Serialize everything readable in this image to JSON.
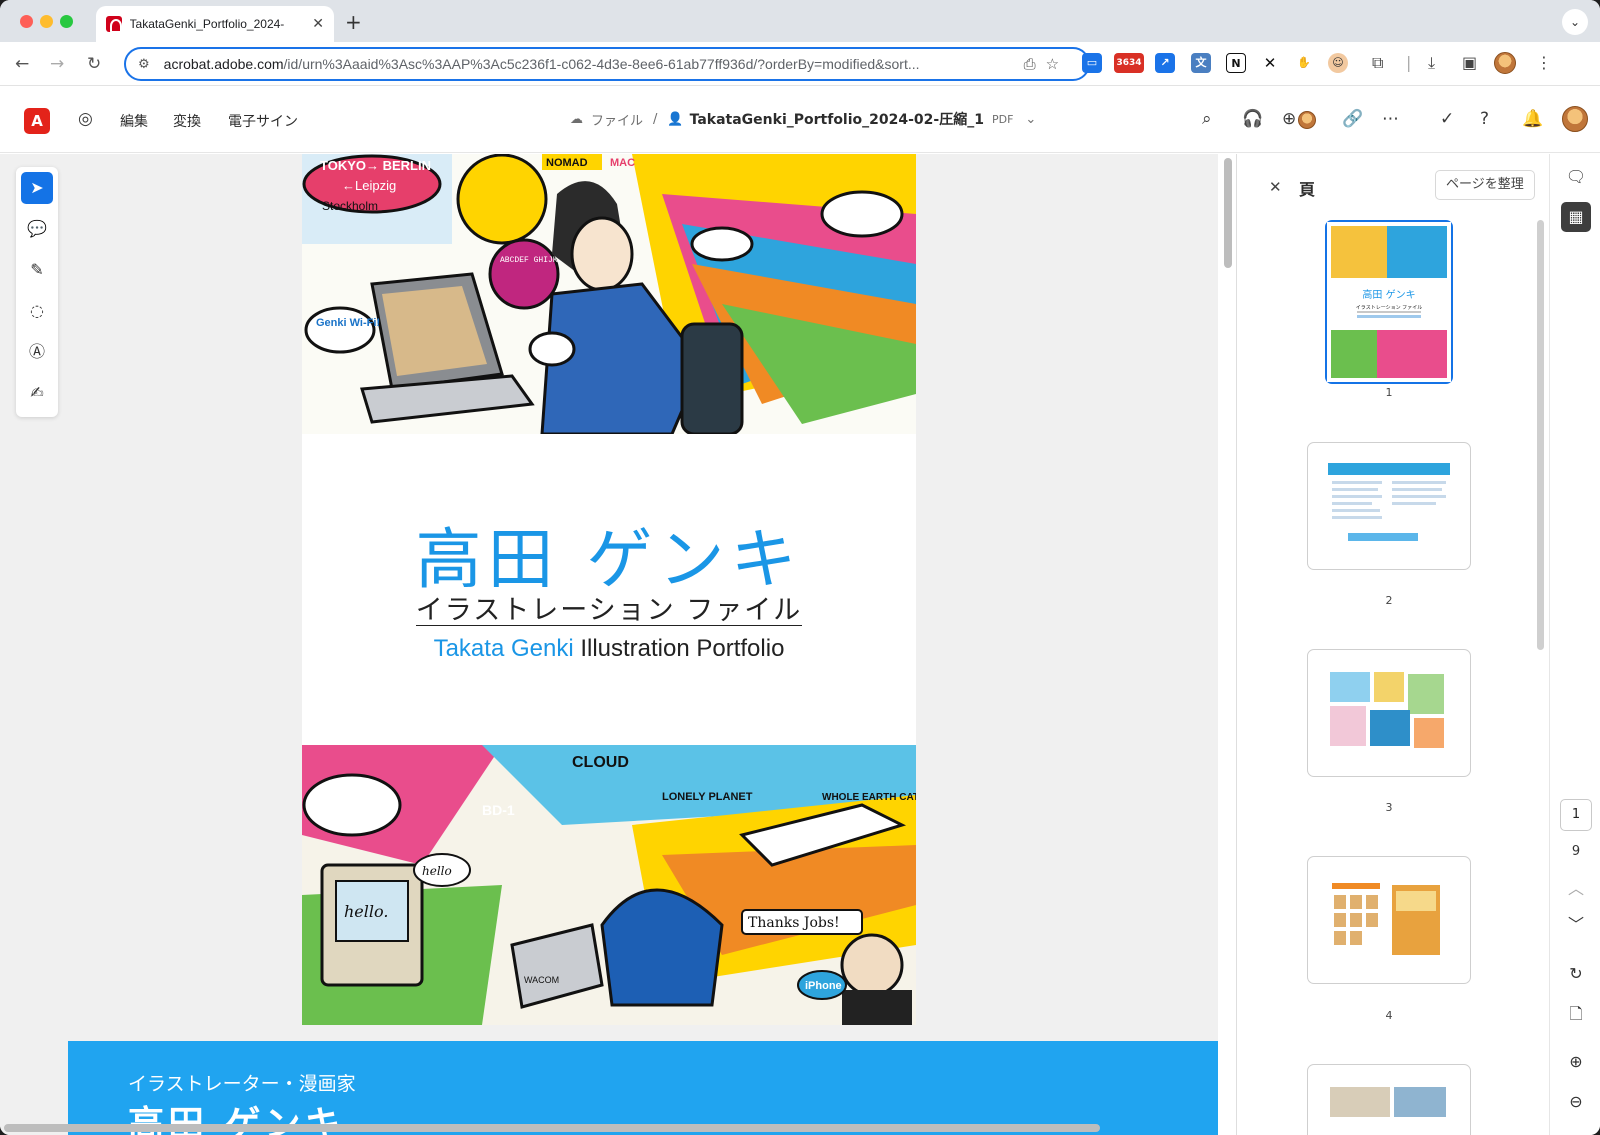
{
  "browser": {
    "tab_title": "TakataGenki_Portfolio_2024-",
    "tab_close": "✕",
    "new_tab": "+",
    "url_host": "acrobat.adobe.com",
    "url_path": "/id/urn%3Aaaid%3Asc%3AAP%3Ac5c236f1-c062-4d3e-8ee6-61ab77ff936d/?orderBy=modified&sort...",
    "extension_badge": "3634"
  },
  "toolbar": {
    "menu_edit": "編集",
    "menu_convert": "変換",
    "menu_esign": "電子サイン",
    "breadcrumb_files": "ファイル",
    "breadcrumb_sep": "/",
    "filename": "TakataGenki_Portfolio_2024-02-圧縮_1",
    "file_type": "PDF"
  },
  "document": {
    "cover": {
      "title_jp": "高田 ゲンキ",
      "subtitle_jp": "イラストレーション ファイル",
      "title_en_name": "Takata Genki",
      "title_en_rest": " Illustration Portfolio"
    },
    "page2": {
      "role": "イラストレーター・漫画家",
      "name": "高田 ゲンキ"
    }
  },
  "art_text": {
    "top": [
      "TOKYO→ BERLIN",
      "←Leipzig",
      "Stockholm",
      "NOMAD",
      "MAC",
      "Genki Wi-Fi!",
      "ABCDEF GHIJKLM NOPQRST UVWXYZ"
    ],
    "bottom": [
      "CLOUD",
      "LONELY PLANET",
      "WHOLE EARTH CATALOG",
      "BD-1",
      "hello.",
      "hello",
      "Thanks Jobs!",
      "iPhone",
      "WACOM"
    ]
  },
  "panel": {
    "title": "頁",
    "close": "✕",
    "organize_button": "ページを整理",
    "thumbnails": [
      {
        "number": "1",
        "title": "高田 ゲンキ",
        "subtitle": "イラストレーション ファイル"
      },
      {
        "number": "2"
      },
      {
        "number": "3"
      },
      {
        "number": "4"
      }
    ]
  },
  "navigation": {
    "current_page": "1",
    "total_pages": "9"
  },
  "colors": {
    "accent": "#1473e6",
    "brand_red": "#e3231a",
    "title_blue": "#1a96e6",
    "page2_blue": "#20a4f0"
  },
  "icons": {
    "select": "arrow-cursor-icon",
    "comment": "comment-icon",
    "draw": "pen-icon",
    "lasso": "lasso-icon",
    "text": "text-box-icon",
    "sign": "signature-icon"
  }
}
